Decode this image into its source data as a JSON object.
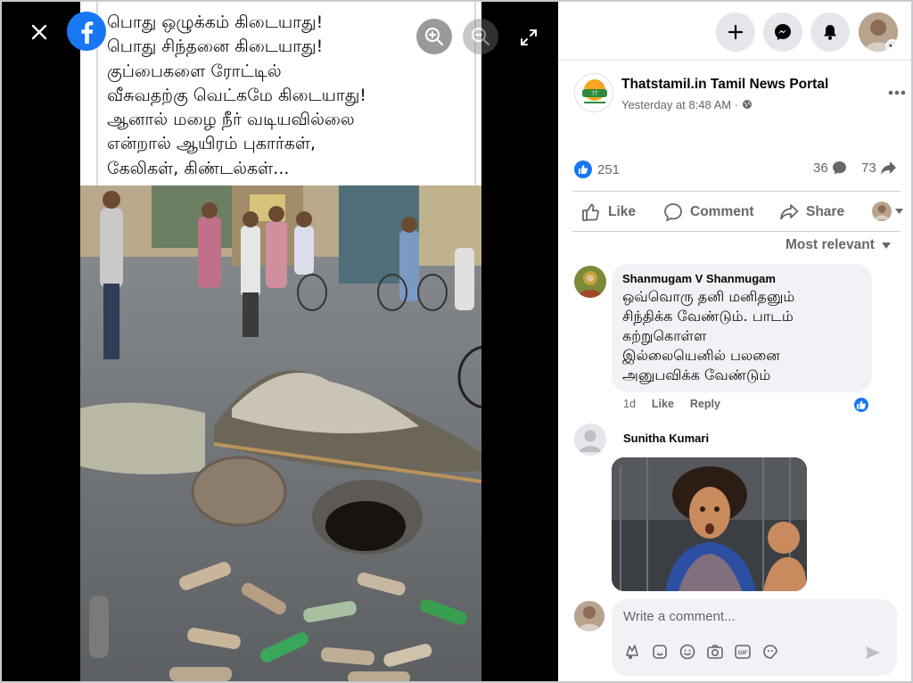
{
  "viewer": {
    "photo_text_lines": [
      "பொது ஒழுக்கம் கிடையாது!",
      "பொது சிந்தனை கிடையாது!",
      "குப்பைகளை ரோட்டில்",
      "வீசுவதற்கு வெட்கமே கிடையாது!",
      "ஆனால் மழை நீர் வடியவில்லை",
      "என்றால் ஆயிரம் புகார்கள்,",
      "கேலிகள், கிண்டல்கள்..."
    ],
    "icons": [
      "close-icon",
      "facebook-logo",
      "zoom-in-icon",
      "zoom-out-icon",
      "expand-icon"
    ]
  },
  "post": {
    "page_name": "Thatstamil.in Tamil News Portal",
    "time": "Yesterday at 8:48 AM · ",
    "reactions_count": "251",
    "comments_count": "36",
    "shares_count": "73"
  },
  "actions": {
    "like": "Like",
    "comment": "Comment",
    "share": "Share"
  },
  "sort_label": "Most relevant",
  "comments": [
    {
      "name": "Shanmugam V Shanmugam",
      "text_lines": [
        "ஒவ்வொரு தனி மனிதனும்",
        "சிந்திக்க வேண்டும். பாடம்",
        "கற்றுகொள்ள",
        "இல்லையெனில் பலனை",
        "அனுபவிக்க வேண்டும்"
      ],
      "age": "1d",
      "like_label": "Like",
      "reply_label": "Reply"
    },
    {
      "name": "Sunitha Kumari"
    }
  ],
  "composer": {
    "placeholder": "Write a comment..."
  },
  "colors": {
    "accent": "#1877f2",
    "secondary_text": "#65676b",
    "button_bg": "#e4e6eb"
  }
}
